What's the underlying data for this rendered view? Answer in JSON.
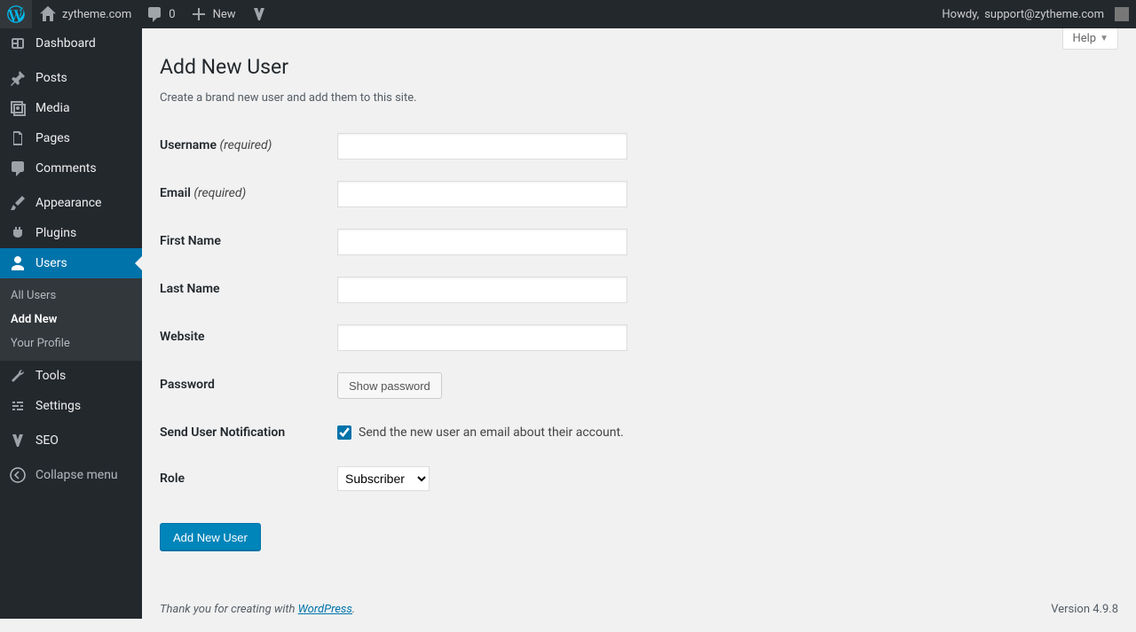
{
  "adminbar": {
    "site_name": "zytheme.com",
    "comments_count": "0",
    "new_label": "New",
    "howdy_prefix": "Howdy, ",
    "howdy_user": "support@zytheme.com"
  },
  "sidebar": {
    "items": [
      {
        "id": "dashboard",
        "label": "Dashboard"
      },
      {
        "id": "posts",
        "label": "Posts"
      },
      {
        "id": "media",
        "label": "Media"
      },
      {
        "id": "pages",
        "label": "Pages"
      },
      {
        "id": "comments",
        "label": "Comments"
      },
      {
        "id": "appearance",
        "label": "Appearance"
      },
      {
        "id": "plugins",
        "label": "Plugins"
      },
      {
        "id": "users",
        "label": "Users"
      },
      {
        "id": "tools",
        "label": "Tools"
      },
      {
        "id": "settings",
        "label": "Settings"
      },
      {
        "id": "seo",
        "label": "SEO"
      }
    ],
    "users_submenu": {
      "all": "All Users",
      "add": "Add New",
      "profile": "Your Profile"
    },
    "collapse": "Collapse menu"
  },
  "help": {
    "label": "Help"
  },
  "page": {
    "title": "Add New User",
    "description": "Create a brand new user and add them to this site.",
    "labels": {
      "username": "Username",
      "email": "Email",
      "required": "(required)",
      "first_name": "First Name",
      "last_name": "Last Name",
      "website": "Website",
      "password": "Password",
      "show_password": "Show password",
      "notification": "Send User Notification",
      "notification_cb": "Send the new user an email about their account.",
      "role": "Role"
    },
    "values": {
      "username": "",
      "email": "",
      "first_name": "",
      "last_name": "",
      "website": "",
      "notification_checked": true,
      "role_selected": "Subscriber"
    },
    "submit": "Add New User"
  },
  "footer": {
    "thanks_prefix": "Thank you for creating with ",
    "wp_link": "WordPress",
    "thanks_suffix": ".",
    "version": "Version 4.9.8"
  }
}
